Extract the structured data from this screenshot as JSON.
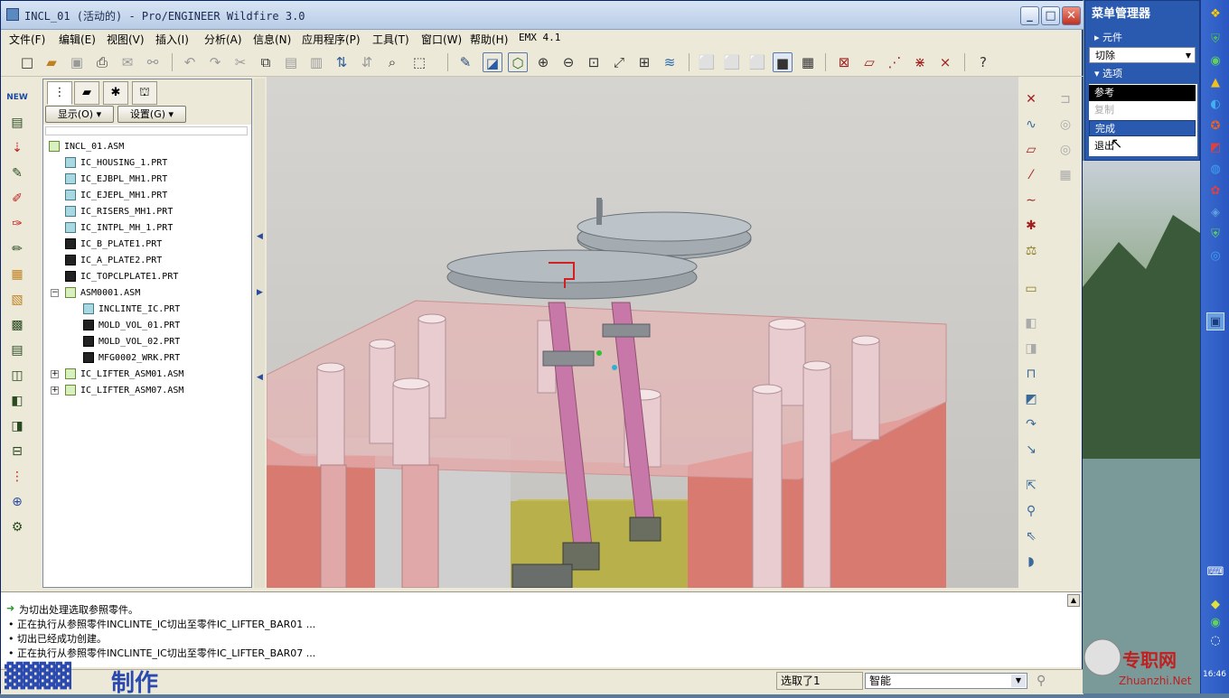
{
  "window": {
    "title": "INCL_01 (活动的) - Pro/ENGINEER Wildfire 3.0",
    "controls": [
      "_",
      "□",
      "✕"
    ]
  },
  "menubar": [
    "文件(F)",
    "编辑(E)",
    "视图(V)",
    "插入(I)",
    "分析(A)",
    "信息(N)",
    "应用程序(P)",
    "工具(T)",
    "窗口(W)",
    "帮助(H)",
    "EMX 4.1"
  ],
  "tree": {
    "show_button": "显示(O) ▾",
    "settings_button": "设置(G) ▾",
    "nodes": [
      {
        "label": "INCL_01.ASM"
      },
      {
        "label": "IC_HOUSING_1.PRT"
      },
      {
        "label": "IC_EJBPL_MH1.PRT"
      },
      {
        "label": "IC_EJEPL_MH1.PRT"
      },
      {
        "label": "IC_RISERS_MH1.PRT"
      },
      {
        "label": "IC_INTPL_MH_1.PRT"
      },
      {
        "label": "IC_B_PLATE1.PRT"
      },
      {
        "label": "IC_A_PLATE2.PRT"
      },
      {
        "label": "IC_TOPCLPLATE1.PRT"
      },
      {
        "label": "ASM0001.ASM"
      },
      {
        "label": "INCLINTE_IC.PRT"
      },
      {
        "label": "MOLD_VOL_01.PRT"
      },
      {
        "label": "MOLD_VOL_02.PRT"
      },
      {
        "label": "MFG0002_WRK.PRT"
      },
      {
        "label": "IC_LIFTER_ASM01.ASM"
      },
      {
        "label": "IC_LIFTER_ASM07.ASM"
      }
    ]
  },
  "messages": [
    "为切出处理选取参照零件。",
    "• 正在执行从参照零件INCLINTE_IC切出至零件IC_LIFTER_BAR01 ...",
    "• 切出已经成功创建。",
    "• 正在执行从参照零件INCLINTE_IC切出至零件IC_LIFTER_BAR07 ..."
  ],
  "status": {
    "selected": "选取了1",
    "filter": "智能"
  },
  "watermark": {
    "text": "制作",
    "site_cn": "专职网",
    "site_url": "Zhuanzhi.Net"
  },
  "menu_manager": {
    "title": "菜单管理器",
    "section_component": "元件",
    "dropdown_value": "切除",
    "section_options": "选项",
    "items": [
      "参考",
      "复制",
      "完成",
      "退出"
    ]
  },
  "taskbar": {
    "clock": "16:46"
  }
}
